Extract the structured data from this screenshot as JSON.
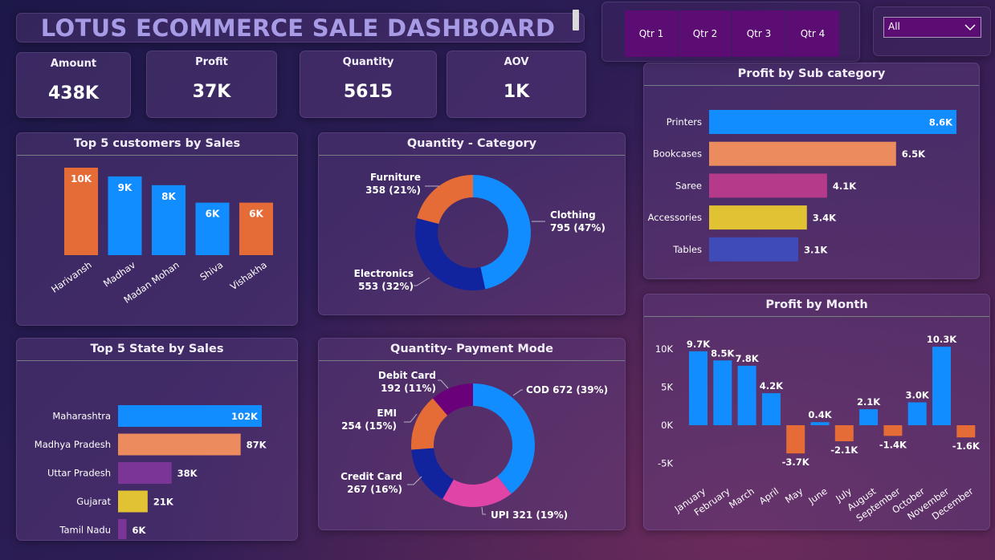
{
  "header": {
    "title": "LOTUS ECOMMERCE SALE DASHBOARD"
  },
  "kpis": [
    {
      "label": "Amount",
      "value": "438K"
    },
    {
      "label": "Profit",
      "value": "37K"
    },
    {
      "label": "Quantity",
      "value": "5615"
    },
    {
      "label": "AOV",
      "value": "1K"
    }
  ],
  "quarter_slicer": {
    "items": [
      "Qtr 1",
      "Qtr 2",
      "Qtr 3",
      "Qtr 4"
    ]
  },
  "dropdown": {
    "value": "All"
  },
  "panels": {
    "customers_title": "Top 5 customers by Sales",
    "category_title": "Quantity - Category",
    "states_title": "Top 5 State by Sales",
    "payment_title": "Quantity- Payment Mode",
    "subcat_title": "Profit by Sub category",
    "month_title": "Profit by Month"
  },
  "colors": {
    "blue": "#118dff",
    "orange": "#e66c37",
    "salmon": "#ec8b5e",
    "magenta": "#b53b8a",
    "purple": "#7b3596",
    "yellow": "#e1c233",
    "indigo": "#3f4bb8",
    "navy": "#12239e",
    "pink": "#e044a7",
    "darkpurple": "#6b007b"
  },
  "chart_data": [
    {
      "id": "customers",
      "type": "bar",
      "categories": [
        "Harivansh",
        "Madhav",
        "Madan Mohan",
        "Shiva",
        "Vishakha"
      ],
      "values": [
        10,
        9,
        8,
        6,
        6
      ],
      "labels": [
        "10K",
        "9K",
        "8K",
        "6K",
        "6K"
      ],
      "bar_colors": [
        "#e66c37",
        "#118dff",
        "#118dff",
        "#118dff",
        "#e66c37"
      ],
      "ylim": [
        0,
        11
      ]
    },
    {
      "id": "category",
      "type": "pie",
      "slices": [
        {
          "label": "Clothing",
          "value": 795,
          "pct": "47%",
          "color": "#118dff"
        },
        {
          "label": "Electronics",
          "value": 553,
          "pct": "32%",
          "color": "#12239e"
        },
        {
          "label": "Furniture",
          "value": 358,
          "pct": "21%",
          "color": "#e66c37"
        }
      ]
    },
    {
      "id": "states",
      "type": "bar",
      "orientation": "horizontal",
      "categories": [
        "Maharashtra",
        "Madhya Pradesh",
        "Uttar Pradesh",
        "Gujarat",
        "Tamil Nadu"
      ],
      "values": [
        102,
        87,
        38,
        21,
        6
      ],
      "labels": [
        "102K",
        "87K",
        "38K",
        "21K",
        "6K"
      ],
      "bar_colors": [
        "#118dff",
        "#ec8b5e",
        "#7b3596",
        "#e1c233",
        "#7b3596"
      ],
      "xlim": [
        0,
        106
      ]
    },
    {
      "id": "payment",
      "type": "pie",
      "slices": [
        {
          "label": "COD",
          "value": 672,
          "pct": "39%",
          "color": "#118dff",
          "text": "COD 672 (39%)"
        },
        {
          "label": "UPI",
          "value": 321,
          "pct": "19%",
          "color": "#e044a7",
          "text": "UPI 321 (19%)"
        },
        {
          "label": "Credit Card",
          "value": 267,
          "pct": "16%",
          "color": "#12239e"
        },
        {
          "label": "EMI",
          "value": 254,
          "pct": "15%",
          "color": "#e66c37"
        },
        {
          "label": "Debit Card",
          "value": 192,
          "pct": "11%",
          "color": "#6b007b"
        }
      ]
    },
    {
      "id": "subcat",
      "type": "bar",
      "orientation": "horizontal",
      "categories": [
        "Printers",
        "Bookcases",
        "Saree",
        "Accessories",
        "Tables"
      ],
      "values": [
        8.6,
        6.5,
        4.1,
        3.4,
        3.1
      ],
      "labels": [
        "8.6K",
        "6.5K",
        "4.1K",
        "3.4K",
        "3.1K"
      ],
      "bar_colors": [
        "#118dff",
        "#ec8b5e",
        "#b53b8a",
        "#e1c233",
        "#3f4bb8"
      ],
      "xlim": [
        0,
        8.6
      ]
    },
    {
      "id": "month",
      "type": "bar",
      "categories": [
        "January",
        "February",
        "March",
        "April",
        "May",
        "June",
        "July",
        "August",
        "September",
        "October",
        "November",
        "December"
      ],
      "values": [
        9.7,
        8.5,
        7.8,
        4.2,
        -3.7,
        0.4,
        -2.1,
        2.1,
        -1.4,
        3.0,
        10.3,
        -1.6
      ],
      "labels": [
        "9.7K",
        "8.5K",
        "7.8K",
        "4.2K",
        "-3.7K",
        "0.4K",
        "-2.1K",
        "2.1K",
        "-1.4K",
        "3.0K",
        "10.3K",
        "-1.6K"
      ],
      "yticks": [
        "10K",
        "5K",
        "0K",
        "-5K"
      ],
      "ylim": [
        -5,
        10
      ],
      "pos_color": "#118dff",
      "neg_color": "#e66c37"
    }
  ]
}
